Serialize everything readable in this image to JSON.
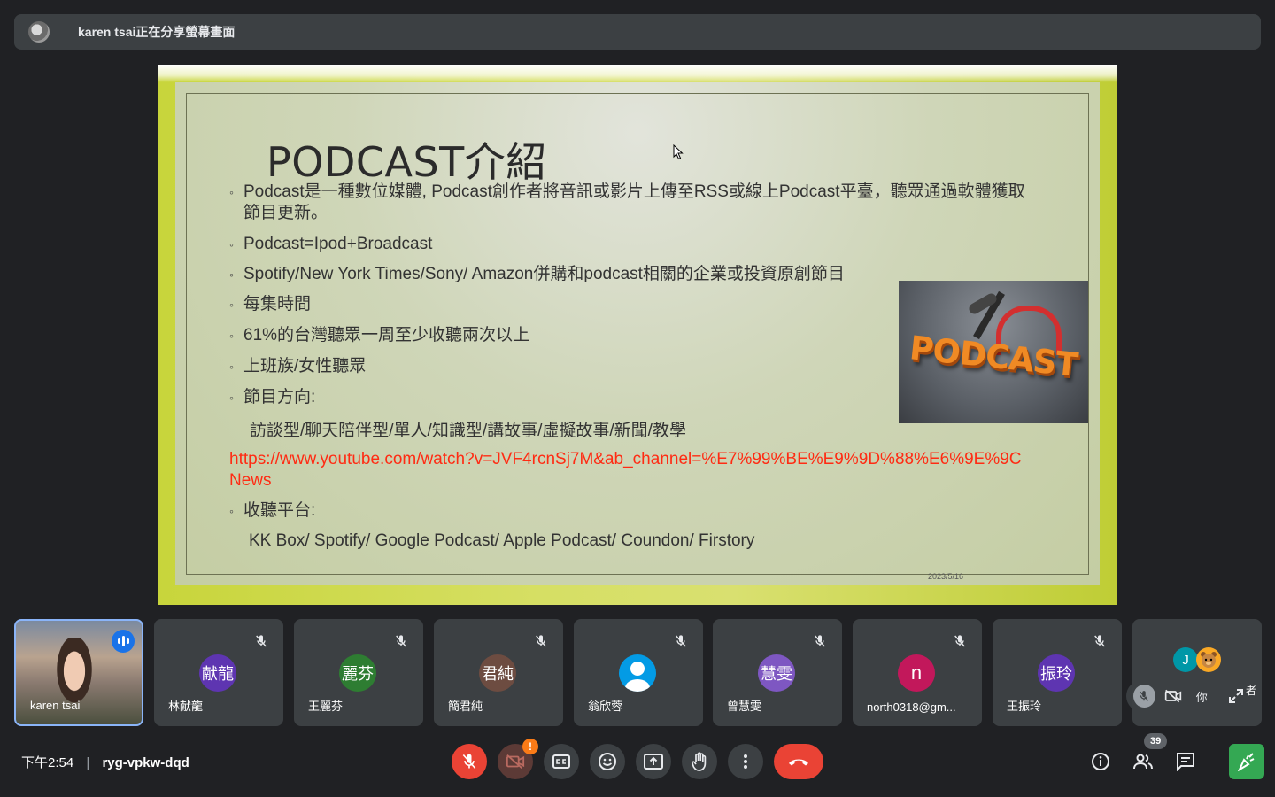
{
  "share_banner": {
    "text": "karen tsai正在分享螢幕畫面"
  },
  "slide": {
    "title": "PODCAST介紹",
    "bullets": [
      "Podcast是一種數位媒體, Podcast創作者將音訊或影片上傳至RSS或線上Podcast平臺，聽眾通過軟體獲取",
      "節目更新。",
      "Podcast=Ipod+Broadcast",
      "Spotify/New York Times/Sony/ Amazon併購和podcast相關的企業或投資原創節目",
      "每集時間",
      "61%的台灣聽眾一周至少收聽兩次以上",
      "上班族/女性聽眾",
      "節目方向:",
      "收聽平台:"
    ],
    "sub_directions": "訪談型/聊天陪伴型/單人/知識型/講故事/虛擬故事/新聞/教學",
    "link_line1": "https://www.youtube.com/watch?v=JVF4rcnSj7M&ab_channel=%E7%99%BE%E9%9D%88%E6%9E%9C",
    "link_line2": "News",
    "sub_platforms": "KK Box/ Spotify/ Google Podcast/ Apple Podcast/ Coundon/ Firstory",
    "image_word": "PODCAST",
    "date": "2023/5/16"
  },
  "participants": [
    {
      "name": "karen tsai",
      "self": true
    },
    {
      "name": "林献龍",
      "initials": "献龍",
      "color": "#5e35b1"
    },
    {
      "name": "王麗芬",
      "initials": "麗芬",
      "color": "#2e7d32"
    },
    {
      "name": "簡君純",
      "initials": "君純",
      "color": "#6d4c41"
    },
    {
      "name": "翁欣蓉",
      "initials": "",
      "color": "#039be5"
    },
    {
      "name": "曾慧雯",
      "initials": "慧雯",
      "color": "#7e57c2"
    },
    {
      "name": "north0318@gm...",
      "initials": "n",
      "color": "#c2185b"
    },
    {
      "name": "王振玲",
      "initials": "振玲",
      "color": "#5e35b1"
    }
  ],
  "more_tile": {
    "initial": "J",
    "label_you": "你",
    "label_tail": "者"
  },
  "bottom": {
    "time": "下午2:54",
    "meeting_code": "ryg-vpkw-dqd",
    "warn": "!",
    "participant_count": "39"
  }
}
